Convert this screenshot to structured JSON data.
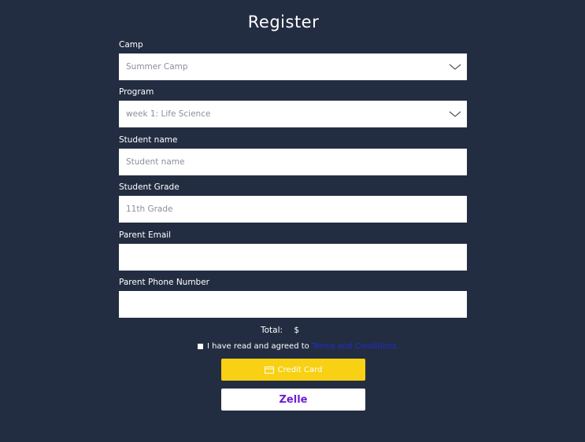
{
  "form": {
    "title": "Register",
    "camp": {
      "label": "Camp",
      "value": "Summer Camp"
    },
    "program": {
      "label": "Program",
      "value": "week 1: Life Science"
    },
    "student_name": {
      "label": "Student name",
      "placeholder": "Student name"
    },
    "student_grade": {
      "label": "Student Grade",
      "value": "11th Grade"
    },
    "parent_email": {
      "label": "Parent Email",
      "value": ""
    },
    "parent_phone": {
      "label": "Parent Phone Number",
      "value": ""
    },
    "total_label": "Total:",
    "currency": "$",
    "terms_text": "I have read and agreed to",
    "terms_link": "Terms and Conditions."
  },
  "buttons": {
    "credit_card": "Credit Card",
    "zelle": "Zelle"
  },
  "colors": {
    "background": "#232d42",
    "credit_card_button": "#f8d014",
    "zelle_text": "#6d1ed4",
    "link": "#1f2bd6"
  },
  "icons": {
    "dropdown": "chevron-down-icon",
    "card": "credit-card-icon"
  }
}
